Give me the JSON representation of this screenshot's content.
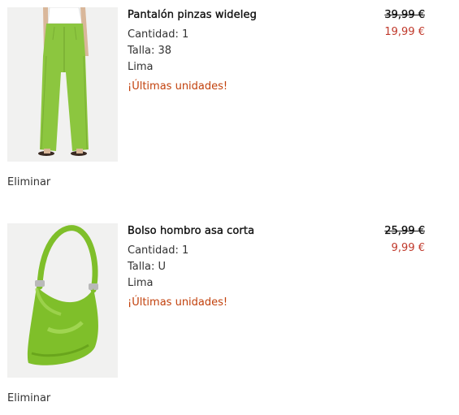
{
  "items": [
    {
      "name": "Pantalón pinzas wideleg",
      "quantity": "Cantidad: 1",
      "size": "Talla: 38",
      "color": "Lima",
      "stock_warning": "¡Últimas unidades!",
      "old_price": "39,99 €",
      "new_price": "19,99 €",
      "remove_label": "Eliminar"
    },
    {
      "name": "Bolso hombro asa corta",
      "quantity": "Cantidad: 1",
      "size": "Talla: U",
      "color": "Lima",
      "stock_warning": "¡Últimas unidades!",
      "old_price": "25,99 €",
      "new_price": "9,99 €",
      "remove_label": "Eliminar"
    }
  ],
  "colors": {
    "warning": "#c2410c",
    "sale_price": "#c0392b",
    "product_lime": "#8cc63f"
  }
}
